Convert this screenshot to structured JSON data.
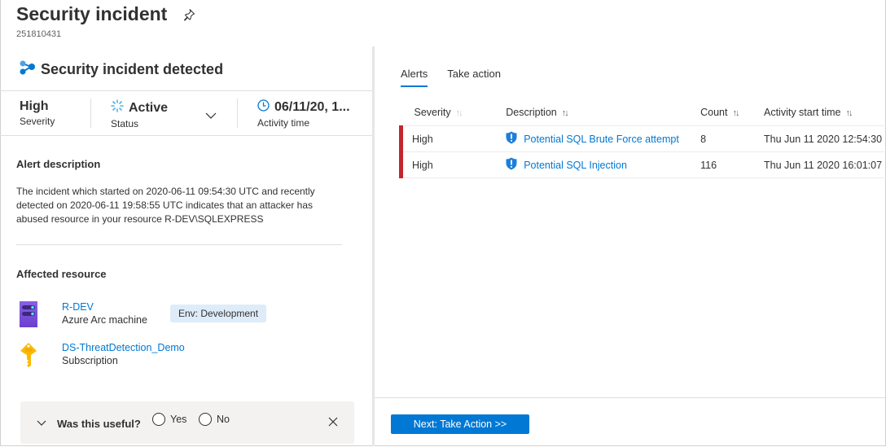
{
  "header": {
    "title": "Security incident",
    "incident_id": "251810431",
    "pin_icon": "pin-icon"
  },
  "left_panel": {
    "title": "Security incident detected",
    "title_icon": "incident-graph-icon",
    "stats": {
      "severity": {
        "value": "High",
        "label": "Severity"
      },
      "status": {
        "value": "Active",
        "label": "Status",
        "icon": "active-spinner-icon"
      },
      "activity_time": {
        "value": "06/11/20, 1...",
        "label": "Activity time",
        "icon": "clock-icon"
      }
    },
    "alert_description": {
      "heading": "Alert description",
      "text": "The incident which started on 2020-06-11 09:54:30 UTC and recently detected on 2020-06-11 19:58:55 UTC indicates that an attacker has abused resource in your resource R-DEV\\SQLEXPRESS"
    },
    "affected_resource": {
      "heading": "Affected resource",
      "items": [
        {
          "name": "R-DEV",
          "type": "Azure Arc machine",
          "icon": "server-icon",
          "tag": "Env: Development"
        },
        {
          "name": "DS-ThreatDetection_Demo",
          "type": "Subscription",
          "icon": "key-icon"
        }
      ]
    },
    "feedback": {
      "question": "Was this useful?",
      "options": [
        "Yes",
        "No"
      ]
    }
  },
  "right_panel": {
    "tabs": [
      {
        "label": "Alerts",
        "active": true
      },
      {
        "label": "Take action",
        "active": false
      }
    ],
    "table": {
      "columns": [
        "Severity",
        "Description",
        "Count",
        "Activity start time"
      ],
      "rows": [
        {
          "severity": "High",
          "description": "Potential SQL Brute Force attempt",
          "count": "8",
          "start_time": "Thu Jun 11 2020 12:54:30"
        },
        {
          "severity": "High",
          "description": "Potential SQL Injection",
          "count": "116",
          "start_time": "Thu Jun 11 2020 16:01:07"
        }
      ]
    },
    "next_button": "Next: Take Action >>"
  },
  "colors": {
    "accent": "#0078d4",
    "severity_high": "#c4262e",
    "tag_bg": "#deecf9"
  }
}
